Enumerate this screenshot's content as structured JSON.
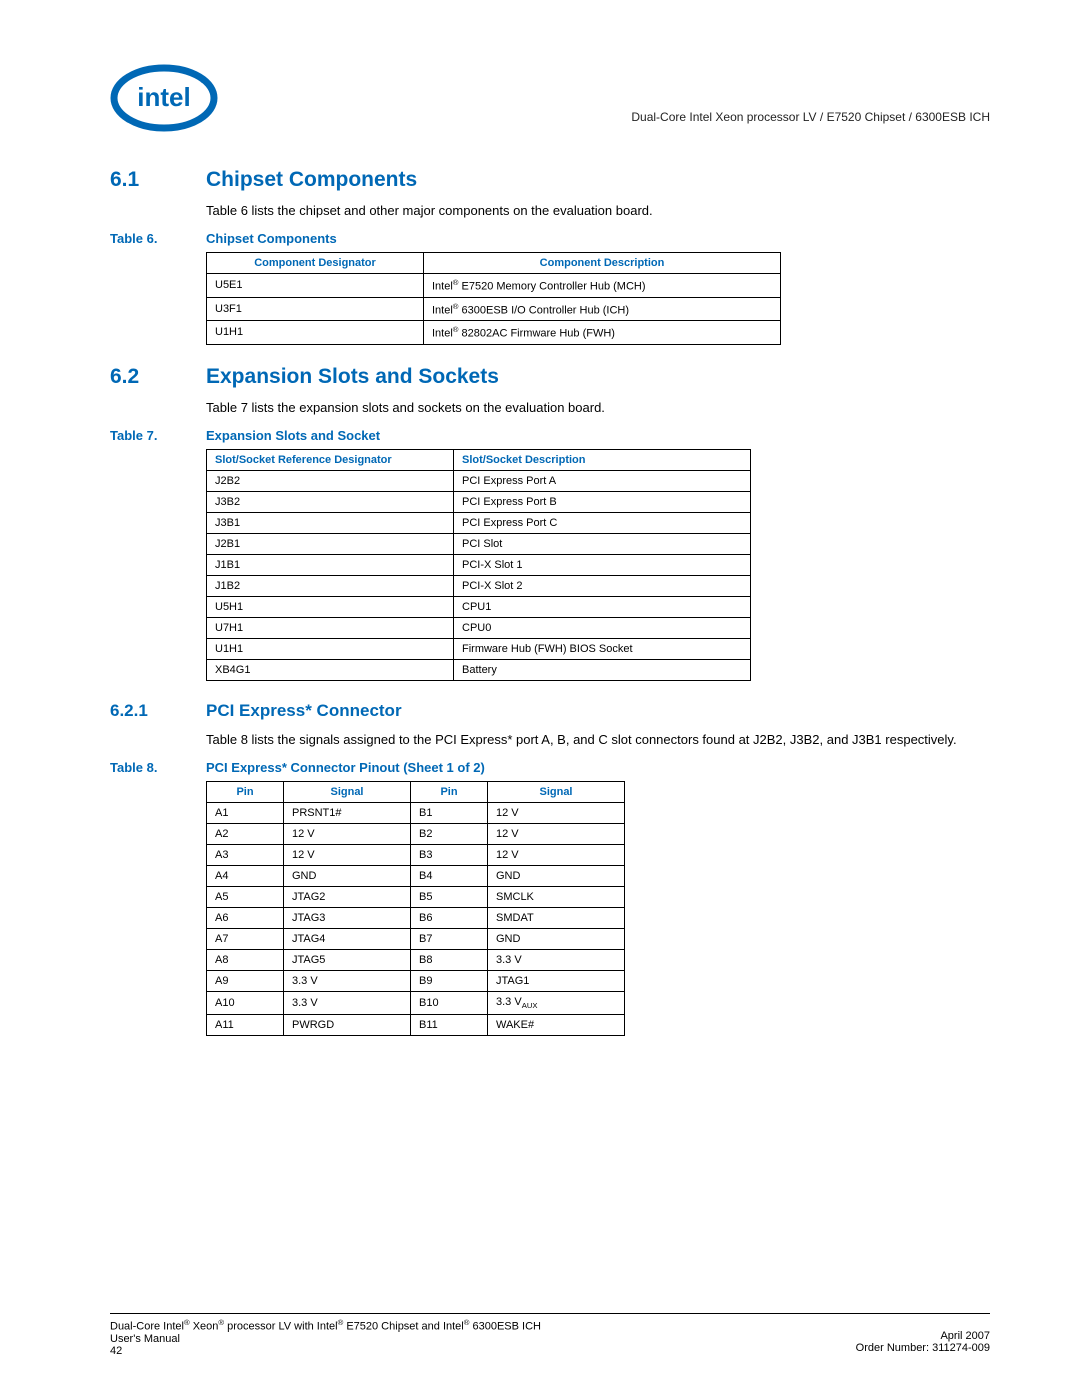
{
  "header": {
    "text": "Dual-Core Intel Xeon processor LV / E7520 Chipset / 6300ESB ICH"
  },
  "section61": {
    "number": "6.1",
    "title": "Chipset Components",
    "intro": "Table 6 lists the chipset and other major components on the evaluation board."
  },
  "table6": {
    "label": "Table 6.",
    "title": "Chipset Components",
    "headers": {
      "col1": "Component Designator",
      "col2": "Component Description"
    },
    "rows": [
      {
        "c1": "U5E1",
        "c2_pre": "Intel",
        "c2_post": " E7520 Memory Controller Hub (MCH)"
      },
      {
        "c1": "U3F1",
        "c2_pre": "Intel",
        "c2_post": " 6300ESB I/O Controller Hub (ICH)"
      },
      {
        "c1": "U1H1",
        "c2_pre": "Intel",
        "c2_post": " 82802AC Firmware Hub (FWH)"
      }
    ]
  },
  "section62": {
    "number": "6.2",
    "title": "Expansion Slots and Sockets",
    "intro": "Table 7 lists the expansion slots and sockets on the evaluation board."
  },
  "table7": {
    "label": "Table 7.",
    "title": "Expansion Slots and Socket",
    "headers": {
      "col1": "Slot/Socket Reference Designator",
      "col2": "Slot/Socket Description"
    },
    "rows": [
      {
        "c1": "J2B2",
        "c2": "PCI Express Port A"
      },
      {
        "c1": "J3B2",
        "c2": "PCI Express Port B"
      },
      {
        "c1": "J3B1",
        "c2": "PCI Express Port C"
      },
      {
        "c1": "J2B1",
        "c2": "PCI Slot"
      },
      {
        "c1": "J1B1",
        "c2": "PCI-X Slot 1"
      },
      {
        "c1": "J1B2",
        "c2": "PCI-X Slot 2"
      },
      {
        "c1": "U5H1",
        "c2": "CPU1"
      },
      {
        "c1": "U7H1",
        "c2": "CPU0"
      },
      {
        "c1": "U1H1",
        "c2": "Firmware Hub (FWH) BIOS Socket"
      },
      {
        "c1": "XB4G1",
        "c2": "Battery"
      }
    ]
  },
  "section621": {
    "number": "6.2.1",
    "title": "PCI Express* Connector",
    "intro": "Table 8 lists the signals assigned to the PCI Express* port A, B, and C slot connectors found at J2B2, J3B2, and J3B1 respectively."
  },
  "table8": {
    "label": "Table 8.",
    "title": "PCI Express* Connector Pinout (Sheet 1 of 2)",
    "headers": {
      "col1": "Pin",
      "col2": "Signal",
      "col3": "Pin",
      "col4": "Signal"
    },
    "rows": [
      {
        "c1": "A1",
        "c2": "PRSNT1#",
        "c3": "B1",
        "c4": "12 V"
      },
      {
        "c1": "A2",
        "c2": "12 V",
        "c3": "B2",
        "c4": "12 V"
      },
      {
        "c1": "A3",
        "c2": "12 V",
        "c3": "B3",
        "c4": "12 V"
      },
      {
        "c1": "A4",
        "c2": "GND",
        "c3": "B4",
        "c4": "GND"
      },
      {
        "c1": "A5",
        "c2": "JTAG2",
        "c3": "B5",
        "c4": "SMCLK"
      },
      {
        "c1": "A6",
        "c2": "JTAG3",
        "c3": "B6",
        "c4": "SMDAT"
      },
      {
        "c1": "A7",
        "c2": "JTAG4",
        "c3": "B7",
        "c4": "GND"
      },
      {
        "c1": "A8",
        "c2": "JTAG5",
        "c3": "B8",
        "c4": "3.3 V"
      },
      {
        "c1": "A9",
        "c2": "3.3 V",
        "c3": "B9",
        "c4": "JTAG1"
      },
      {
        "c1": "A10",
        "c2": "3.3 V",
        "c3": "B10",
        "c4_pre": "3.3 V",
        "c4_sub": "AUX"
      },
      {
        "c1": "A11",
        "c2": "PWRGD",
        "c3": "B11",
        "c4": "WAKE#"
      }
    ]
  },
  "footer": {
    "left_line1_a": "Dual-Core Intel",
    "left_line1_b": " Xeon",
    "left_line1_c": " processor LV with Intel",
    "left_line1_d": " E7520 Chipset and Intel",
    "left_line1_e": " 6300ESB ICH",
    "left_line2": "User's Manual",
    "left_line3": "42",
    "right_line1": "April 2007",
    "right_line2": "Order Number: 311274-009"
  }
}
